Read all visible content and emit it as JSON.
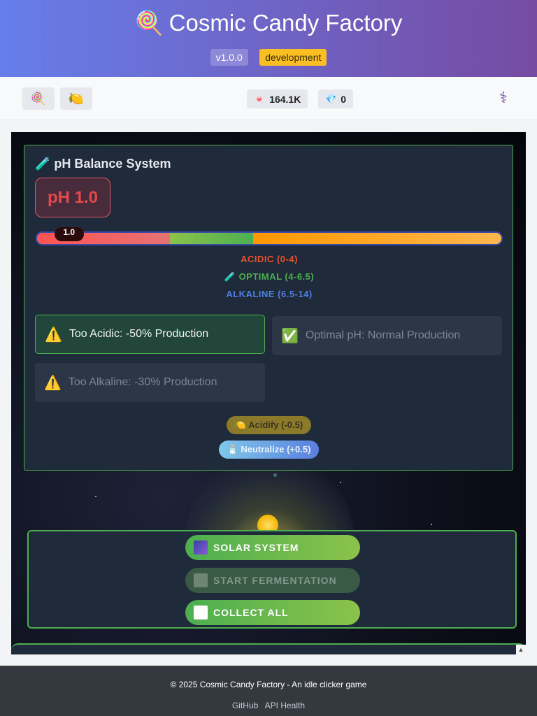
{
  "header": {
    "title": "Cosmic Candy Factory",
    "title_icon": "🍭",
    "version": "v1.0.0",
    "environment": "development"
  },
  "toolbar": {
    "tab1_icon": "🍭",
    "tab2_icon": "🍋",
    "candy_icon": "🍬",
    "candy_count": "164.1K",
    "gem_icon": "💎",
    "gem_count": "0",
    "health_icon": "⚕"
  },
  "ph": {
    "title": "🧪 pH Balance System",
    "current": "pH 1.0",
    "marker": "1.0",
    "value": 1.0,
    "scale_max": 14,
    "ranges": {
      "acidic": "ACIDIC (0-4)",
      "optimal": "🧪 OPTIMAL (4-6.5)",
      "alkaline": "ALKALINE (6.5-14)"
    },
    "effects": {
      "acidic_icon": "⚠️",
      "acidic": "Too Acidic: -50% Production",
      "optimal_icon": "✅",
      "optimal": "Optimal pH: Normal Production",
      "alkaline_icon": "⚠️",
      "alkaline": "Too Alkaline: -30% Production"
    },
    "actions": {
      "acidify": "🍋 Acidify (-0.5)",
      "neutralize": "🧂 Neutralize (+0.5)"
    }
  },
  "controls": {
    "solar_system": "SOLAR SYSTEM",
    "start_fermentation": "START FERMENTATION",
    "collect_all": "COLLECT ALL"
  },
  "footer": {
    "copyright": "© 2025 Cosmic Candy Factory - An idle clicker game",
    "link_github": "GitHub",
    "link_api": "API Health"
  },
  "colors": {
    "header_start": "#667eea",
    "header_end": "#764ba2",
    "accent_green": "#4caf50",
    "acidic_red": "#e34a4a",
    "alkaline_blue": "#4f7fe0"
  }
}
